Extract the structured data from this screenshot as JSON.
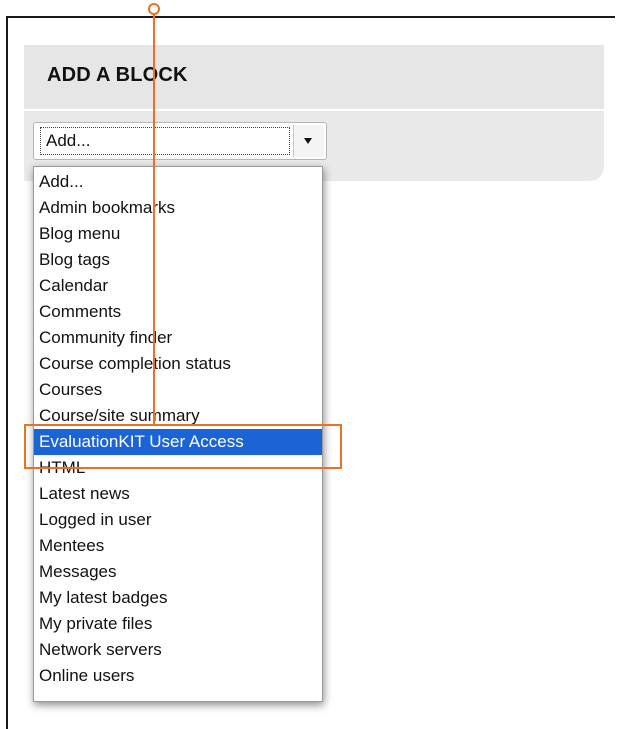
{
  "block": {
    "title": "ADD A BLOCK"
  },
  "select": {
    "value": "Add..."
  },
  "dropdown": {
    "options": [
      "Add...",
      "Admin bookmarks",
      "Blog menu",
      "Blog tags",
      "Calendar",
      "Comments",
      "Community finder",
      "Course completion status",
      "Courses",
      "Course/site summary",
      "EvaluationKIT User Access",
      "HTML",
      "Latest news",
      "Logged in user",
      "Mentees",
      "Messages",
      "My latest badges",
      "My private files",
      "Network servers",
      "Online users"
    ],
    "selected_option": "EvaluationKIT User Access"
  },
  "colors": {
    "highlight": "#1a64d6",
    "annotation": "#e8731f"
  }
}
